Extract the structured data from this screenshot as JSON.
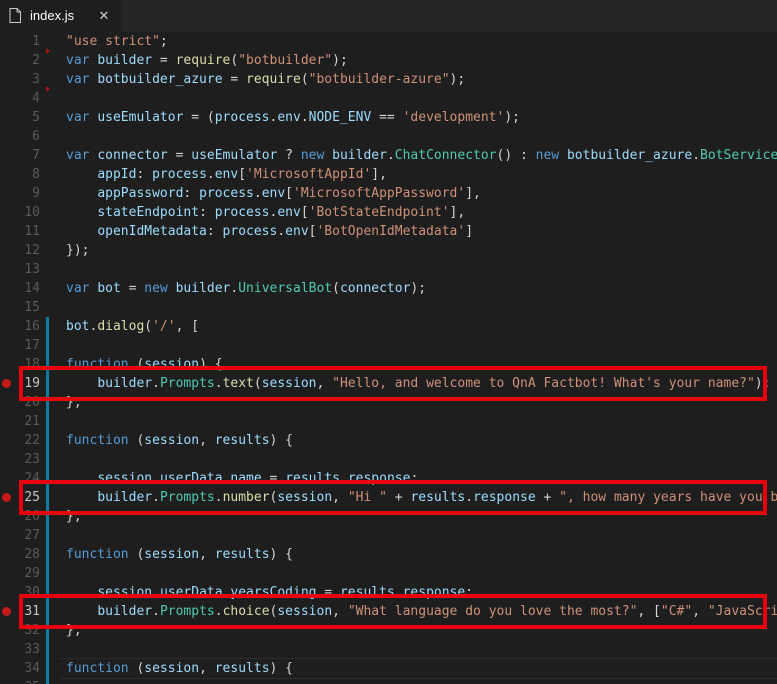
{
  "tab": {
    "filename": "index.js",
    "close": "✕",
    "icon": "file-icon"
  },
  "colors": {
    "breakpoint": "#c31b1b",
    "annotation": "#e8000d",
    "git_bar": "#0c7d9d",
    "background": "#1e1e1e"
  },
  "lines": [
    {
      "n": "1",
      "tokens": [
        [
          "str",
          "\"use strict\""
        ],
        [
          "pun",
          ";"
        ]
      ]
    },
    {
      "n": "2",
      "tokens": [
        [
          "kw",
          "var "
        ],
        [
          "var",
          "builder"
        ],
        [
          "pun",
          " = "
        ],
        [
          "fn",
          "require"
        ],
        [
          "pun",
          "("
        ],
        [
          "str",
          "\"botbuilder\""
        ],
        [
          "pun",
          ");"
        ]
      ]
    },
    {
      "n": "3",
      "tokens": [
        [
          "kw",
          "var "
        ],
        [
          "var",
          "botbuilder_azure"
        ],
        [
          "pun",
          " = "
        ],
        [
          "fn",
          "require"
        ],
        [
          "pun",
          "("
        ],
        [
          "str",
          "\"botbuilder-azure\""
        ],
        [
          "pun",
          ");"
        ]
      ]
    },
    {
      "n": "4",
      "tokens": []
    },
    {
      "n": "5",
      "tokens": [
        [
          "kw",
          "var "
        ],
        [
          "var",
          "useEmulator"
        ],
        [
          "pun",
          " = ("
        ],
        [
          "var",
          "process"
        ],
        [
          "pun",
          "."
        ],
        [
          "var",
          "env"
        ],
        [
          "pun",
          "."
        ],
        [
          "var",
          "NODE_ENV"
        ],
        [
          "pun",
          " == "
        ],
        [
          "str",
          "'development'"
        ],
        [
          "pun",
          ");"
        ]
      ]
    },
    {
      "n": "6",
      "tokens": []
    },
    {
      "n": "7",
      "tokens": [
        [
          "kw",
          "var "
        ],
        [
          "var",
          "connector"
        ],
        [
          "pun",
          " = "
        ],
        [
          "var",
          "useEmulator"
        ],
        [
          "pun",
          " ? "
        ],
        [
          "kw",
          "new "
        ],
        [
          "var",
          "builder"
        ],
        [
          "pun",
          "."
        ],
        [
          "cls",
          "ChatConnector"
        ],
        [
          "pun",
          "() : "
        ],
        [
          "kw",
          "new "
        ],
        [
          "var",
          "botbuilder_azure"
        ],
        [
          "pun",
          "."
        ],
        [
          "cls",
          "BotServiceConnector"
        ],
        [
          "pun",
          "({"
        ]
      ]
    },
    {
      "n": "8",
      "tokens": [
        [
          "pun",
          "    "
        ],
        [
          "var",
          "appId"
        ],
        [
          "pun",
          ": "
        ],
        [
          "var",
          "process"
        ],
        [
          "pun",
          "."
        ],
        [
          "var",
          "env"
        ],
        [
          "pun",
          "["
        ],
        [
          "str",
          "'MicrosoftAppId'"
        ],
        [
          "pun",
          "],"
        ]
      ]
    },
    {
      "n": "9",
      "tokens": [
        [
          "pun",
          "    "
        ],
        [
          "var",
          "appPassword"
        ],
        [
          "pun",
          ": "
        ],
        [
          "var",
          "process"
        ],
        [
          "pun",
          "."
        ],
        [
          "var",
          "env"
        ],
        [
          "pun",
          "["
        ],
        [
          "str",
          "'MicrosoftAppPassword'"
        ],
        [
          "pun",
          "],"
        ]
      ]
    },
    {
      "n": "10",
      "tokens": [
        [
          "pun",
          "    "
        ],
        [
          "var",
          "stateEndpoint"
        ],
        [
          "pun",
          ": "
        ],
        [
          "var",
          "process"
        ],
        [
          "pun",
          "."
        ],
        [
          "var",
          "env"
        ],
        [
          "pun",
          "["
        ],
        [
          "str",
          "'BotStateEndpoint'"
        ],
        [
          "pun",
          "],"
        ]
      ]
    },
    {
      "n": "11",
      "tokens": [
        [
          "pun",
          "    "
        ],
        [
          "var",
          "openIdMetadata"
        ],
        [
          "pun",
          ": "
        ],
        [
          "var",
          "process"
        ],
        [
          "pun",
          "."
        ],
        [
          "var",
          "env"
        ],
        [
          "pun",
          "["
        ],
        [
          "str",
          "'BotOpenIdMetadata'"
        ],
        [
          "pun",
          "]"
        ]
      ]
    },
    {
      "n": "12",
      "tokens": [
        [
          "pun",
          "});"
        ]
      ]
    },
    {
      "n": "13",
      "tokens": []
    },
    {
      "n": "14",
      "tokens": [
        [
          "kw",
          "var "
        ],
        [
          "var",
          "bot"
        ],
        [
          "pun",
          " = "
        ],
        [
          "kw",
          "new "
        ],
        [
          "var",
          "builder"
        ],
        [
          "pun",
          "."
        ],
        [
          "cls",
          "UniversalBot"
        ],
        [
          "pun",
          "("
        ],
        [
          "var",
          "connector"
        ],
        [
          "pun",
          ");"
        ]
      ]
    },
    {
      "n": "15",
      "tokens": []
    },
    {
      "n": "16",
      "tokens": [
        [
          "var",
          "bot"
        ],
        [
          "pun",
          "."
        ],
        [
          "fn",
          "dialog"
        ],
        [
          "pun",
          "("
        ],
        [
          "str",
          "'/'"
        ],
        [
          "pun",
          ", ["
        ]
      ]
    },
    {
      "n": "17",
      "tokens": []
    },
    {
      "n": "18",
      "tokens": [
        [
          "kw",
          "function "
        ],
        [
          "pun",
          "("
        ],
        [
          "var",
          "session"
        ],
        [
          "pun",
          ") {"
        ]
      ]
    },
    {
      "n": "19",
      "bp": true,
      "tokens": [
        [
          "pun",
          "    "
        ],
        [
          "var",
          "builder"
        ],
        [
          "pun",
          "."
        ],
        [
          "cls",
          "Prompts"
        ],
        [
          "pun",
          "."
        ],
        [
          "fn",
          "text"
        ],
        [
          "pun",
          "("
        ],
        [
          "var",
          "session"
        ],
        [
          "pun",
          ", "
        ],
        [
          "str",
          "\"Hello, and welcome to QnA Factbot! What's your name?\""
        ],
        [
          "pun",
          ");"
        ]
      ]
    },
    {
      "n": "20",
      "tokens": [
        [
          "pun",
          "},"
        ]
      ]
    },
    {
      "n": "21",
      "tokens": []
    },
    {
      "n": "22",
      "tokens": [
        [
          "kw",
          "function "
        ],
        [
          "pun",
          "("
        ],
        [
          "var",
          "session"
        ],
        [
          "pun",
          ", "
        ],
        [
          "var",
          "results"
        ],
        [
          "pun",
          ") {"
        ]
      ]
    },
    {
      "n": "23",
      "tokens": []
    },
    {
      "n": "24",
      "tokens": [
        [
          "pun",
          "    "
        ],
        [
          "var",
          "session"
        ],
        [
          "pun",
          "."
        ],
        [
          "var",
          "userData"
        ],
        [
          "pun",
          "."
        ],
        [
          "var",
          "name"
        ],
        [
          "pun",
          " = "
        ],
        [
          "var",
          "results"
        ],
        [
          "pun",
          "."
        ],
        [
          "var",
          "response"
        ],
        [
          "pun",
          ";"
        ]
      ]
    },
    {
      "n": "25",
      "bp": true,
      "tokens": [
        [
          "pun",
          "    "
        ],
        [
          "var",
          "builder"
        ],
        [
          "pun",
          "."
        ],
        [
          "cls",
          "Prompts"
        ],
        [
          "pun",
          "."
        ],
        [
          "fn",
          "number"
        ],
        [
          "pun",
          "("
        ],
        [
          "var",
          "session"
        ],
        [
          "pun",
          ", "
        ],
        [
          "str",
          "\"Hi \""
        ],
        [
          "pun",
          " + "
        ],
        [
          "var",
          "results"
        ],
        [
          "pun",
          "."
        ],
        [
          "var",
          "response"
        ],
        [
          "pun",
          " + "
        ],
        [
          "str",
          "\", how many years have you been coding?\""
        ],
        [
          "pun",
          ");"
        ]
      ]
    },
    {
      "n": "26",
      "tokens": [
        [
          "pun",
          "},"
        ]
      ]
    },
    {
      "n": "27",
      "tokens": []
    },
    {
      "n": "28",
      "tokens": [
        [
          "kw",
          "function "
        ],
        [
          "pun",
          "("
        ],
        [
          "var",
          "session"
        ],
        [
          "pun",
          ", "
        ],
        [
          "var",
          "results"
        ],
        [
          "pun",
          ") {"
        ]
      ]
    },
    {
      "n": "29",
      "tokens": []
    },
    {
      "n": "30",
      "tokens": [
        [
          "pun",
          "    "
        ],
        [
          "var",
          "session"
        ],
        [
          "pun",
          "."
        ],
        [
          "var",
          "userData"
        ],
        [
          "pun",
          "."
        ],
        [
          "var",
          "yearsCoding"
        ],
        [
          "pun",
          " = "
        ],
        [
          "var",
          "results"
        ],
        [
          "pun",
          "."
        ],
        [
          "var",
          "response"
        ],
        [
          "pun",
          ";"
        ]
      ]
    },
    {
      "n": "31",
      "bp": true,
      "tokens": [
        [
          "pun",
          "    "
        ],
        [
          "var",
          "builder"
        ],
        [
          "pun",
          "."
        ],
        [
          "cls",
          "Prompts"
        ],
        [
          "pun",
          "."
        ],
        [
          "fn",
          "choice"
        ],
        [
          "pun",
          "("
        ],
        [
          "var",
          "session"
        ],
        [
          "pun",
          ", "
        ],
        [
          "str",
          "\"What language do you love the most?\""
        ],
        [
          "pun",
          ", ["
        ],
        [
          "str",
          "\"C#\""
        ],
        [
          "pun",
          ", "
        ],
        [
          "str",
          "\"JavaScript\""
        ],
        [
          "pun",
          "]);"
        ]
      ]
    },
    {
      "n": "32",
      "tokens": [
        [
          "pun",
          "},"
        ]
      ]
    },
    {
      "n": "33",
      "tokens": []
    },
    {
      "n": "34",
      "tokens": [
        [
          "kw",
          "function "
        ],
        [
          "pun",
          "("
        ],
        [
          "var",
          "session"
        ],
        [
          "pun",
          ", "
        ],
        [
          "var",
          "results"
        ],
        [
          "pun",
          ") {"
        ]
      ]
    },
    {
      "n": "35",
      "tokens": []
    }
  ]
}
